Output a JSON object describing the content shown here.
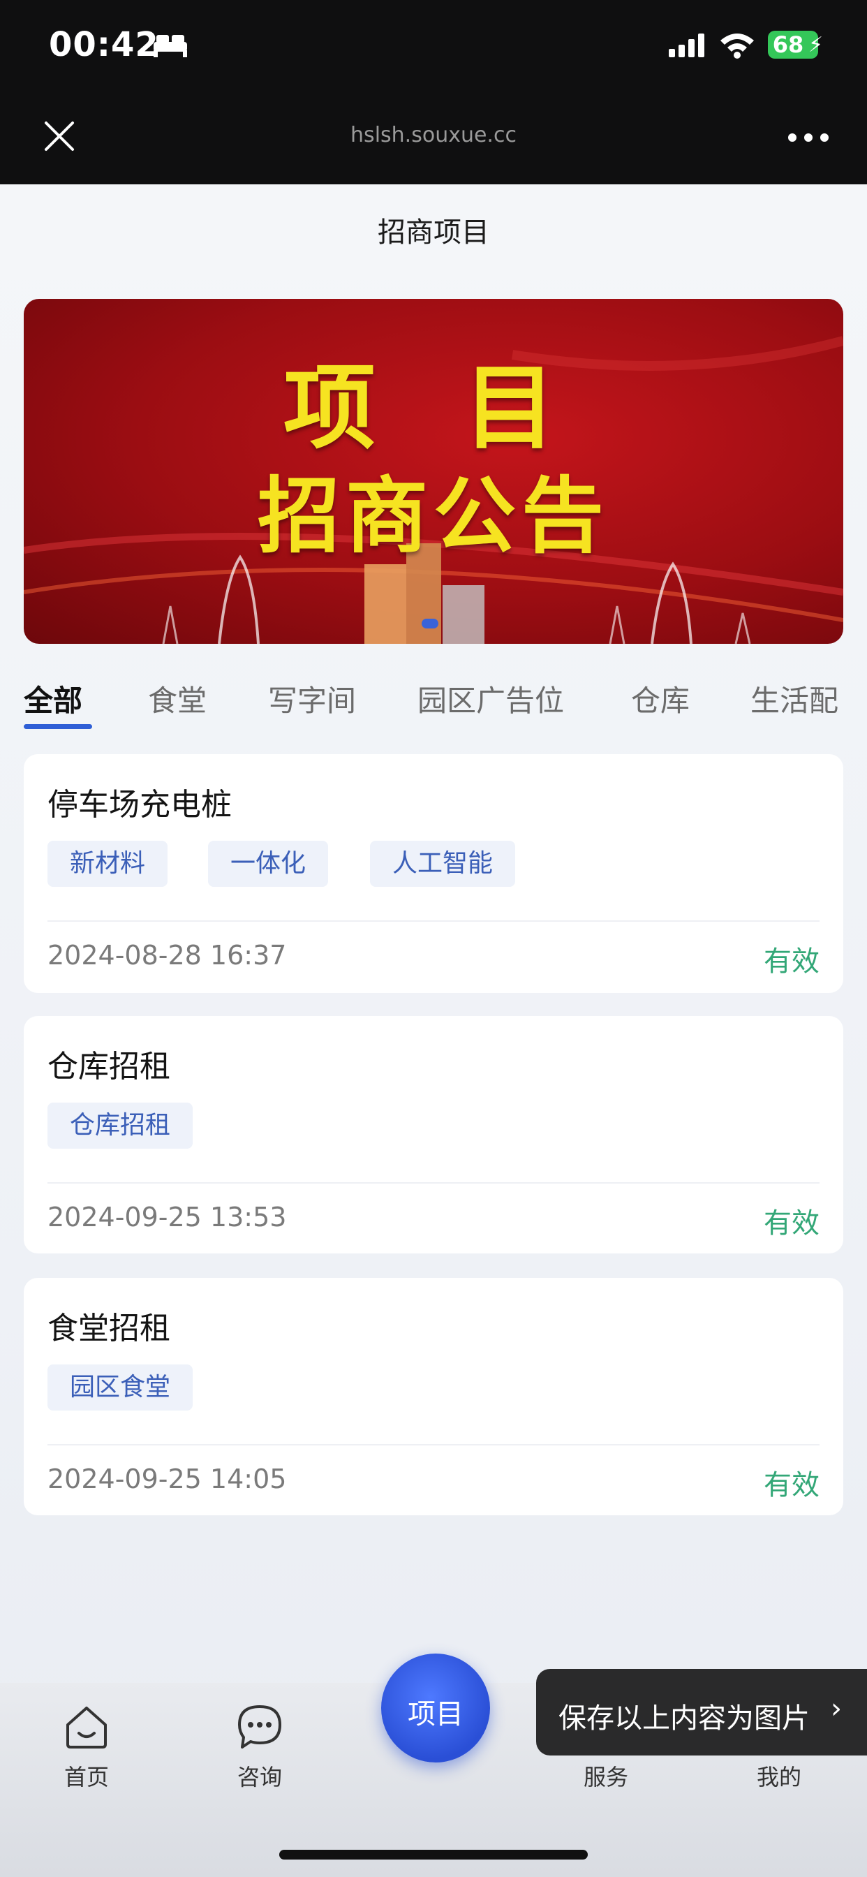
{
  "status_bar": {
    "time": "00:42",
    "battery": "68"
  },
  "browser": {
    "url": "hslsh.souxue.cc"
  },
  "page": {
    "title": "招商项目"
  },
  "banner": {
    "line1": "项 目",
    "line2": "招商公告"
  },
  "tabs": [
    {
      "label": "全部",
      "active": true
    },
    {
      "label": "食堂"
    },
    {
      "label": "写字间"
    },
    {
      "label": "园区广告位"
    },
    {
      "label": "仓库"
    },
    {
      "label": "生活配"
    }
  ],
  "projects": [
    {
      "title": "停车场充电桩",
      "tags": [
        "新材料",
        "一体化",
        "人工智能"
      ],
      "date": "2024-08-28 16:37",
      "status": "有效"
    },
    {
      "title": "仓库招租",
      "tags": [
        "仓库招租"
      ],
      "date": "2024-09-25 13:53",
      "status": "有效"
    },
    {
      "title": "食堂招租",
      "tags": [
        "园区食堂"
      ],
      "date": "2024-09-25 14:05",
      "status": "有效"
    }
  ],
  "bottom_nav": {
    "home": "首页",
    "consult": "咨询",
    "center": "项目",
    "service": "服务",
    "mine": "我的"
  },
  "toast": {
    "text": "保存以上内容为图片",
    "chevron": "›"
  },
  "colors": {
    "accent": "#2f5fd6",
    "status_valid": "#33a777",
    "tag_text": "#3b5fb8"
  }
}
